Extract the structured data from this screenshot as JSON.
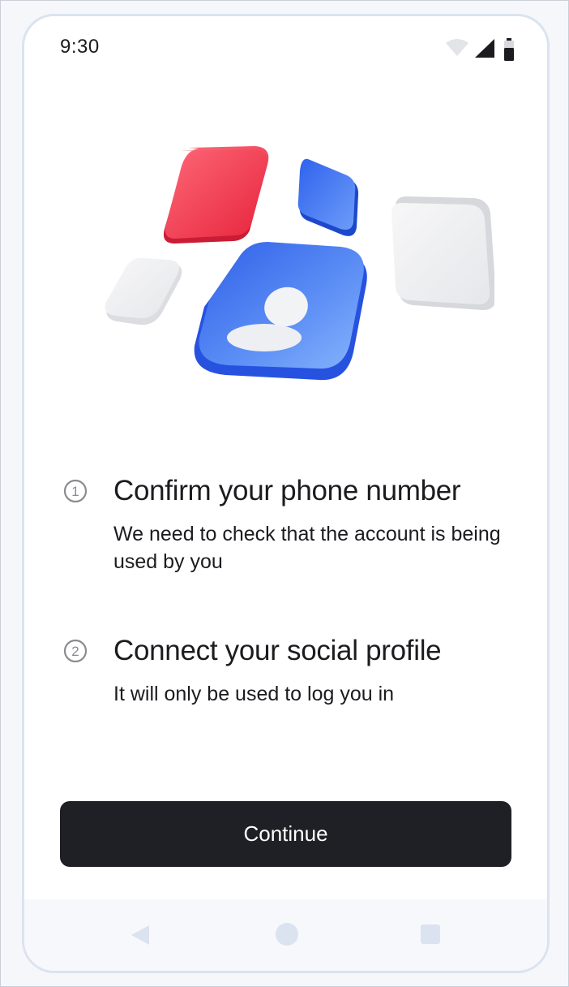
{
  "status_bar": {
    "time": "9:30",
    "icons": [
      "wifi-icon",
      "cellular-signal-icon",
      "battery-icon"
    ]
  },
  "illustration": {
    "icon": "user-profile-icon",
    "colors": {
      "red": "#f0384e",
      "blue": "#3f74f0",
      "light": "#eceef2"
    }
  },
  "steps": [
    {
      "number_symbol": "1",
      "title": "Confirm your phone number",
      "description": "We need to check that the account is being used by you"
    },
    {
      "number_symbol": "2",
      "title": "Connect your social profile",
      "description": "It will only be used to log you in"
    }
  ],
  "continue_button": {
    "label": "Continue",
    "color": "#1e2025"
  },
  "nav_bar": {
    "icons": [
      "back-icon",
      "home-icon",
      "recents-icon"
    ]
  }
}
